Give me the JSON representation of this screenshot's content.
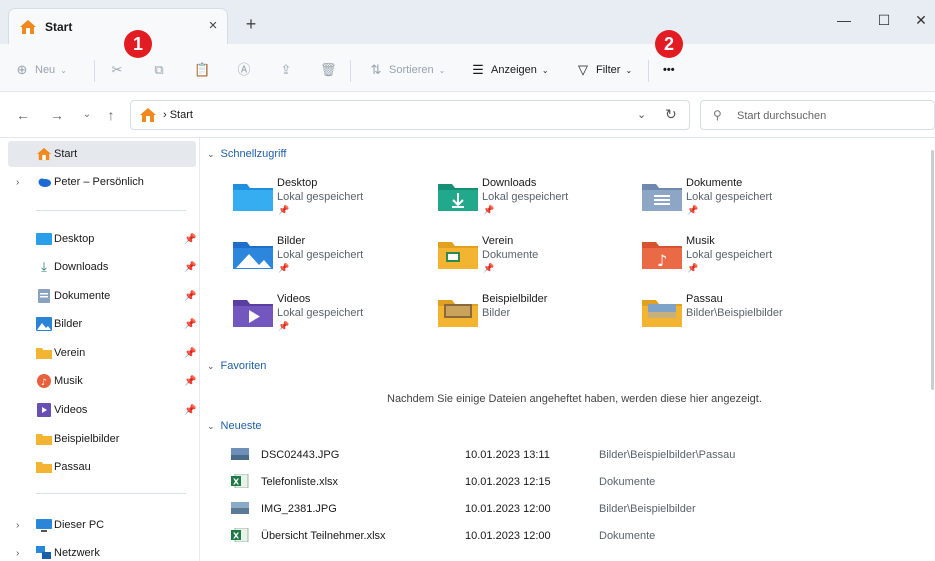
{
  "window": {
    "tab_label": "Start",
    "tab_close": "×",
    "new_tab": "+",
    "minimize": "—",
    "maximize": "☐",
    "close": "✕"
  },
  "toolbar": {
    "new_label": "Neu",
    "sort_label": "Sortieren",
    "view_label": "Anzeigen",
    "filter_label": "Filter",
    "more_label": "•••",
    "badge1": "1",
    "badge2": "2"
  },
  "address": {
    "crumb": "› Start",
    "search_placeholder": "Start durchsuchen"
  },
  "sidebar": {
    "start": "Start",
    "personal": "Peter – Persönlich",
    "items": [
      {
        "label": "Desktop",
        "icon": "desktop-icon"
      },
      {
        "label": "Downloads",
        "icon": "download-icon"
      },
      {
        "label": "Dokumente",
        "icon": "document-icon"
      },
      {
        "label": "Bilder",
        "icon": "pictures-icon"
      },
      {
        "label": "Verein",
        "icon": "folder-icon"
      },
      {
        "label": "Musik",
        "icon": "music-icon"
      },
      {
        "label": "Videos",
        "icon": "video-icon"
      },
      {
        "label": "Beispielbilder",
        "icon": "folder-icon"
      },
      {
        "label": "Passau",
        "icon": "folder-icon"
      }
    ],
    "this_pc": "Dieser PC",
    "network": "Netzwerk"
  },
  "main": {
    "quick_access_title": "Schnellzugriff",
    "quick_access": [
      {
        "name": "Desktop",
        "sub": "Lokal gespeichert",
        "pinned": true
      },
      {
        "name": "Downloads",
        "sub": "Lokal gespeichert",
        "pinned": true
      },
      {
        "name": "Dokumente",
        "sub": "Lokal gespeichert",
        "pinned": true
      },
      {
        "name": "Bilder",
        "sub": "Lokal gespeichert",
        "pinned": true
      },
      {
        "name": "Verein",
        "sub": "Dokumente",
        "pinned": true
      },
      {
        "name": "Musik",
        "sub": "Lokal gespeichert",
        "pinned": true
      },
      {
        "name": "Videos",
        "sub": "Lokal gespeichert",
        "pinned": true
      },
      {
        "name": "Beispielbilder",
        "sub": "Bilder",
        "pinned": false
      },
      {
        "name": "Passau",
        "sub": "Bilder\\Beispielbilder",
        "pinned": false
      }
    ],
    "favorites_title": "Favoriten",
    "favorites_empty": "Nachdem Sie einige Dateien angeheftet haben, werden diese hier angezeigt.",
    "recent_title": "Neueste",
    "recent": [
      {
        "name": "DSC02443.JPG",
        "date": "10.01.2023 13:11",
        "location": "Bilder\\Beispielbilder\\Passau",
        "type": "image"
      },
      {
        "name": "Telefonliste.xlsx",
        "date": "10.01.2023 12:15",
        "location": "Dokumente",
        "type": "excel"
      },
      {
        "name": "IMG_2381.JPG",
        "date": "10.01.2023 12:00",
        "location": "Bilder\\Beispielbilder",
        "type": "image"
      },
      {
        "name": "Übersicht Teilnehmer.xlsx",
        "date": "10.01.2023 12:00",
        "location": "Dokumente",
        "type": "excel"
      }
    ]
  },
  "colors": {
    "accent": "#1f5fa8",
    "badge": "#e31b23",
    "folder": "#f3b431"
  }
}
